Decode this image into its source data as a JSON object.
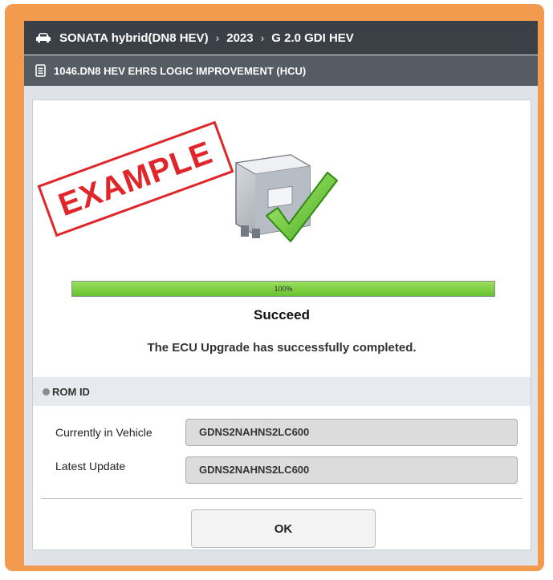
{
  "header": {
    "vehicle_icon": "car-icon",
    "model": "SONATA hybrid(DN8 HEV)",
    "year": "2023",
    "engine": "G 2.0 GDI HEV",
    "separator": "›"
  },
  "subheader": {
    "doc_icon": "document-icon",
    "title": "1046.DN8 HEV EHRS LOGIC IMPROVEMENT (HCU)"
  },
  "stamp": {
    "text": "EXAMPLE",
    "color": "#e0262a"
  },
  "progress": {
    "value": 1.0,
    "label": "100%",
    "color": "#66c22e"
  },
  "status": {
    "title": "Succeed",
    "message": "The ECU Upgrade has successfully completed."
  },
  "rom": {
    "header": "ROM ID",
    "rows": [
      {
        "label": "Currently in Vehicle",
        "value": "GDNS2NAHNS2LC600"
      },
      {
        "label": "Latest Update",
        "value": "GDNS2NAHNS2LC600"
      }
    ]
  },
  "buttons": {
    "ok": "OK"
  },
  "colors": {
    "frame": "#f29b4e",
    "header_bg": "#3b4047",
    "subheader_bg": "#565c64"
  }
}
